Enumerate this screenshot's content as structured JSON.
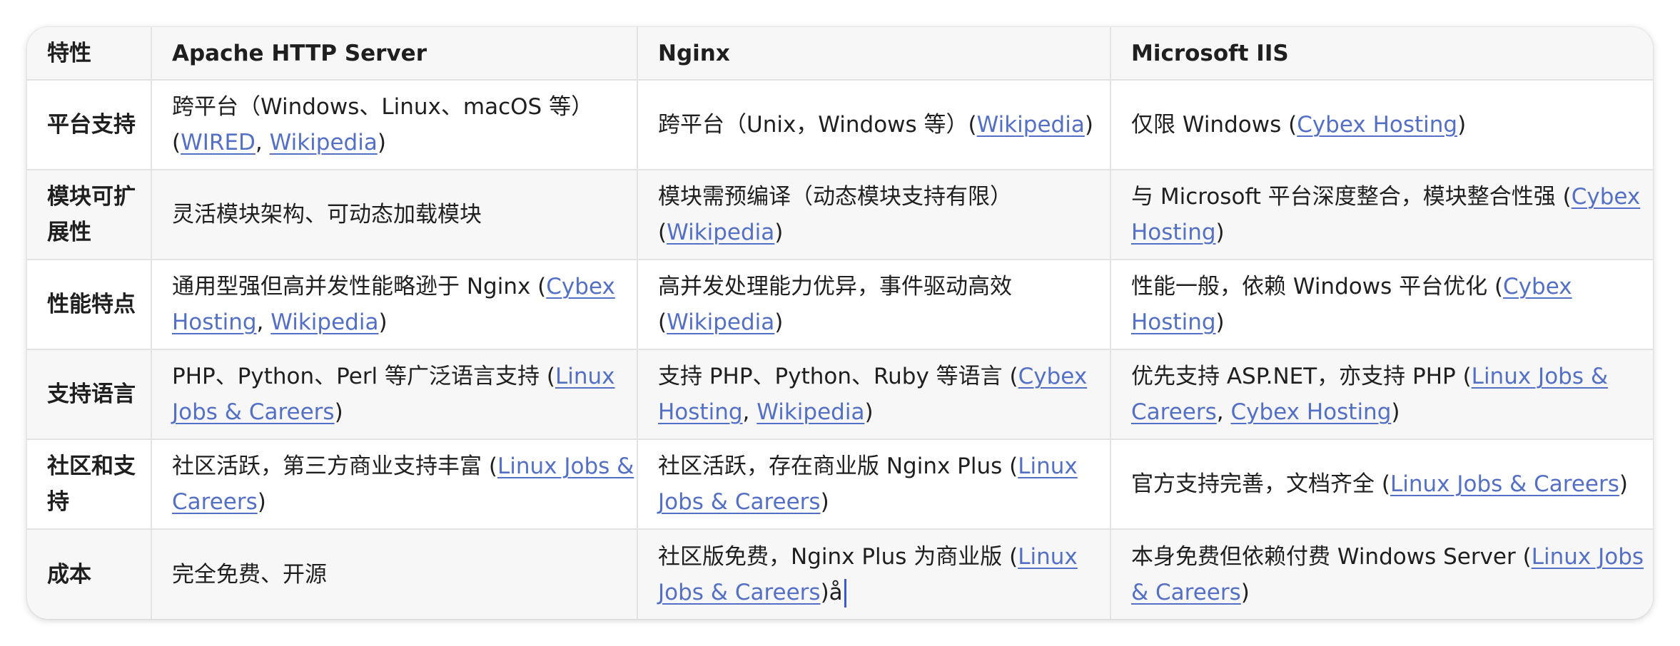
{
  "table": {
    "headers": [
      "特性",
      "Apache HTTP Server",
      "Nginx",
      "Microsoft IIS"
    ],
    "rows": [
      {
        "feature": "平台支持",
        "cells": [
          [
            {
              "t": "跨平台（Windows、Linux、macOS 等）("
            },
            {
              "t": "WIRED",
              "link": true
            },
            {
              "t": ", "
            },
            {
              "t": "Wikipedia",
              "link": true
            },
            {
              "t": ")"
            }
          ],
          [
            {
              "t": "跨平台（Unix，Windows 等）("
            },
            {
              "t": "Wikipedia",
              "link": true
            },
            {
              "t": ")"
            }
          ],
          [
            {
              "t": "仅限 Windows ("
            },
            {
              "t": "Cybex Hosting",
              "link": true
            },
            {
              "t": ")"
            }
          ]
        ]
      },
      {
        "feature": "模块可扩展性",
        "cells": [
          [
            {
              "t": "灵活模块架构、可动态加载模块"
            }
          ],
          [
            {
              "t": "模块需预编译（动态模块支持有限）("
            },
            {
              "t": "Wikipedia",
              "link": true
            },
            {
              "t": ")"
            }
          ],
          [
            {
              "t": "与 Microsoft 平台深度整合，模块整合性强 ("
            },
            {
              "t": "Cybex Hosting",
              "link": true
            },
            {
              "t": ")"
            }
          ]
        ]
      },
      {
        "feature": "性能特点",
        "cells": [
          [
            {
              "t": "通用型强但高并发性能略逊于 Nginx ("
            },
            {
              "t": "Cybex Hosting",
              "link": true
            },
            {
              "t": ", "
            },
            {
              "t": "Wikipedia",
              "link": true
            },
            {
              "t": ")"
            }
          ],
          [
            {
              "t": "高并发处理能力优异，事件驱动高效 ("
            },
            {
              "t": "Wikipedia",
              "link": true
            },
            {
              "t": ")"
            }
          ],
          [
            {
              "t": "性能一般，依赖 Windows 平台优化 ("
            },
            {
              "t": "Cybex Hosting",
              "link": true
            },
            {
              "t": ")"
            }
          ]
        ]
      },
      {
        "feature": "支持语言",
        "cells": [
          [
            {
              "t": "PHP、Python、Perl 等广泛语言支持 ("
            },
            {
              "t": "Linux Jobs & Careers",
              "link": true
            },
            {
              "t": ")"
            }
          ],
          [
            {
              "t": "支持 PHP、Python、Ruby 等语言 ("
            },
            {
              "t": "Cybex Hosting",
              "link": true
            },
            {
              "t": ", "
            },
            {
              "t": "Wikipedia",
              "link": true
            },
            {
              "t": ")"
            }
          ],
          [
            {
              "t": "优先支持 ASP.NET，亦支持 PHP ("
            },
            {
              "t": "Linux Jobs & Careers",
              "link": true
            },
            {
              "t": ", "
            },
            {
              "t": "Cybex Hosting",
              "link": true
            },
            {
              "t": ")"
            }
          ]
        ]
      },
      {
        "feature": "社区和支持",
        "cells": [
          [
            {
              "t": "社区活跃，第三方商业支持丰富 ("
            },
            {
              "t": "Linux Jobs & Careers",
              "link": true
            },
            {
              "t": ")"
            }
          ],
          [
            {
              "t": "社区活跃，存在商业版 Nginx Plus ("
            },
            {
              "t": "Linux Jobs & Careers",
              "link": true
            },
            {
              "t": ")"
            }
          ],
          [
            {
              "t": "官方支持完善，文档齐全 ("
            },
            {
              "t": "Linux Jobs & Careers",
              "link": true
            },
            {
              "t": ")"
            }
          ]
        ]
      },
      {
        "feature": "成本",
        "cells": [
          [
            {
              "t": "完全免费、开源"
            }
          ],
          [
            {
              "t": "社区版免费，Nginx Plus 为商业版 ("
            },
            {
              "t": "Linux Jobs & Careers",
              "link": true
            },
            {
              "t": ")å"
            }
          ],
          [
            {
              "t": "本身免费但依赖付费 Windows Server ("
            },
            {
              "t": "Linux Jobs & Careers",
              "link": true
            },
            {
              "t": ")"
            }
          ]
        ]
      }
    ]
  },
  "colors": {
    "link": "#5470c6",
    "border": "#e3e3e3",
    "stripe": "#f7f7f7",
    "caret": "#3a5bd0"
  }
}
